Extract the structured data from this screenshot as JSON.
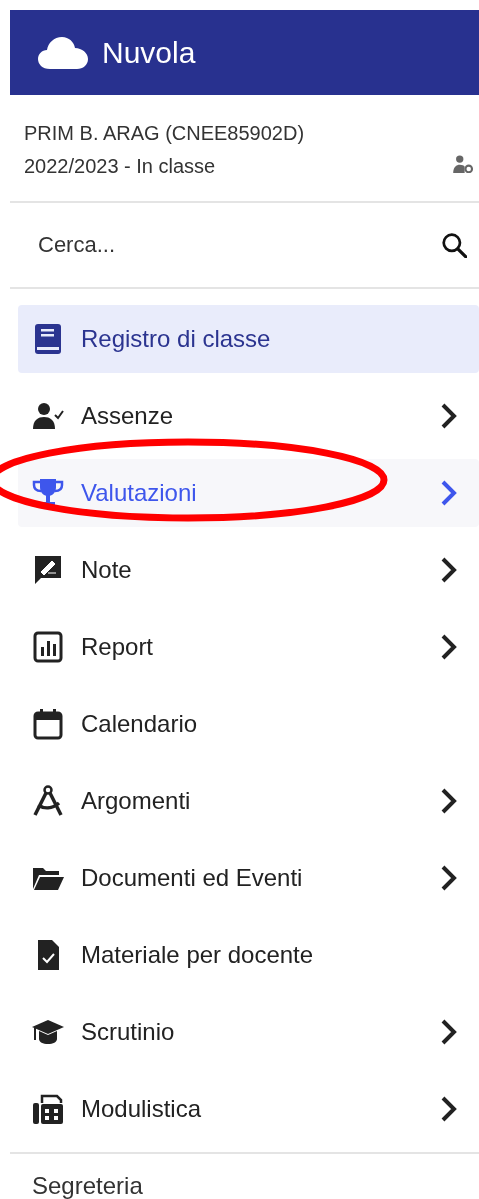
{
  "app": {
    "title": "Nuvola"
  },
  "school": {
    "name": "PRIM B. ARAG (CNEE85902D)",
    "period": "2022/2023 - In classe"
  },
  "search": {
    "placeholder": "Cerca..."
  },
  "menu": [
    {
      "label": "Registro di classe",
      "selected": true,
      "hovered": false,
      "expandable": false
    },
    {
      "label": "Assenze",
      "selected": false,
      "hovered": false,
      "expandable": true
    },
    {
      "label": "Valutazioni",
      "selected": false,
      "hovered": true,
      "expandable": true
    },
    {
      "label": "Note",
      "selected": false,
      "hovered": false,
      "expandable": true
    },
    {
      "label": "Report",
      "selected": false,
      "hovered": false,
      "expandable": true
    },
    {
      "label": "Calendario",
      "selected": false,
      "hovered": false,
      "expandable": false
    },
    {
      "label": "Argomenti",
      "selected": false,
      "hovered": false,
      "expandable": true
    },
    {
      "label": "Documenti ed Eventi",
      "selected": false,
      "hovered": false,
      "expandable": true
    },
    {
      "label": "Materiale per docente",
      "selected": false,
      "hovered": false,
      "expandable": false
    },
    {
      "label": "Scrutinio",
      "selected": false,
      "hovered": false,
      "expandable": true
    },
    {
      "label": "Modulistica",
      "selected": false,
      "hovered": false,
      "expandable": true
    }
  ],
  "section": {
    "label": "Segreteria"
  }
}
